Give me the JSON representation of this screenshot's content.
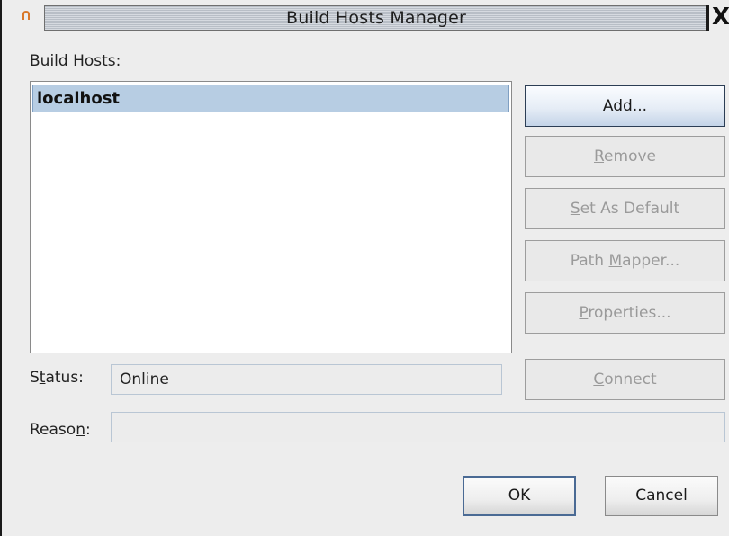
{
  "window": {
    "title": "Build Hosts Manager",
    "close_glyph": "X",
    "app_icon": "netbeans-app-icon"
  },
  "hosts": {
    "label_prefix": "",
    "label_mnemonic": "B",
    "label_rest": "uild Hosts:",
    "items": [
      {
        "name": "localhost",
        "selected": true
      }
    ]
  },
  "actions": {
    "add": {
      "pre": "",
      "key": "A",
      "post": "dd...",
      "enabled": true
    },
    "remove": {
      "pre": "",
      "key": "R",
      "post": "emove",
      "enabled": false
    },
    "set_default": {
      "pre": "",
      "key": "S",
      "post": "et As Default",
      "enabled": false
    },
    "path_mapper": {
      "pre": "Path ",
      "key": "M",
      "post": "apper...",
      "enabled": false
    },
    "properties": {
      "pre": "",
      "key": "P",
      "post": "roperties...",
      "enabled": false
    },
    "connect": {
      "pre": "",
      "key": "C",
      "post": "onnect",
      "enabled": false
    }
  },
  "status": {
    "label_pre": "S",
    "label_key": "t",
    "label_post": "atus:",
    "value": "Online"
  },
  "reason": {
    "label_pre": "Reaso",
    "label_key": "n",
    "label_post": ":",
    "value": ""
  },
  "footer": {
    "ok_label": "OK",
    "cancel_label": "Cancel"
  },
  "colors": {
    "selection": "#b7cde3",
    "window_bg": "#ededed",
    "disabled_text": "#9a9a9a"
  }
}
